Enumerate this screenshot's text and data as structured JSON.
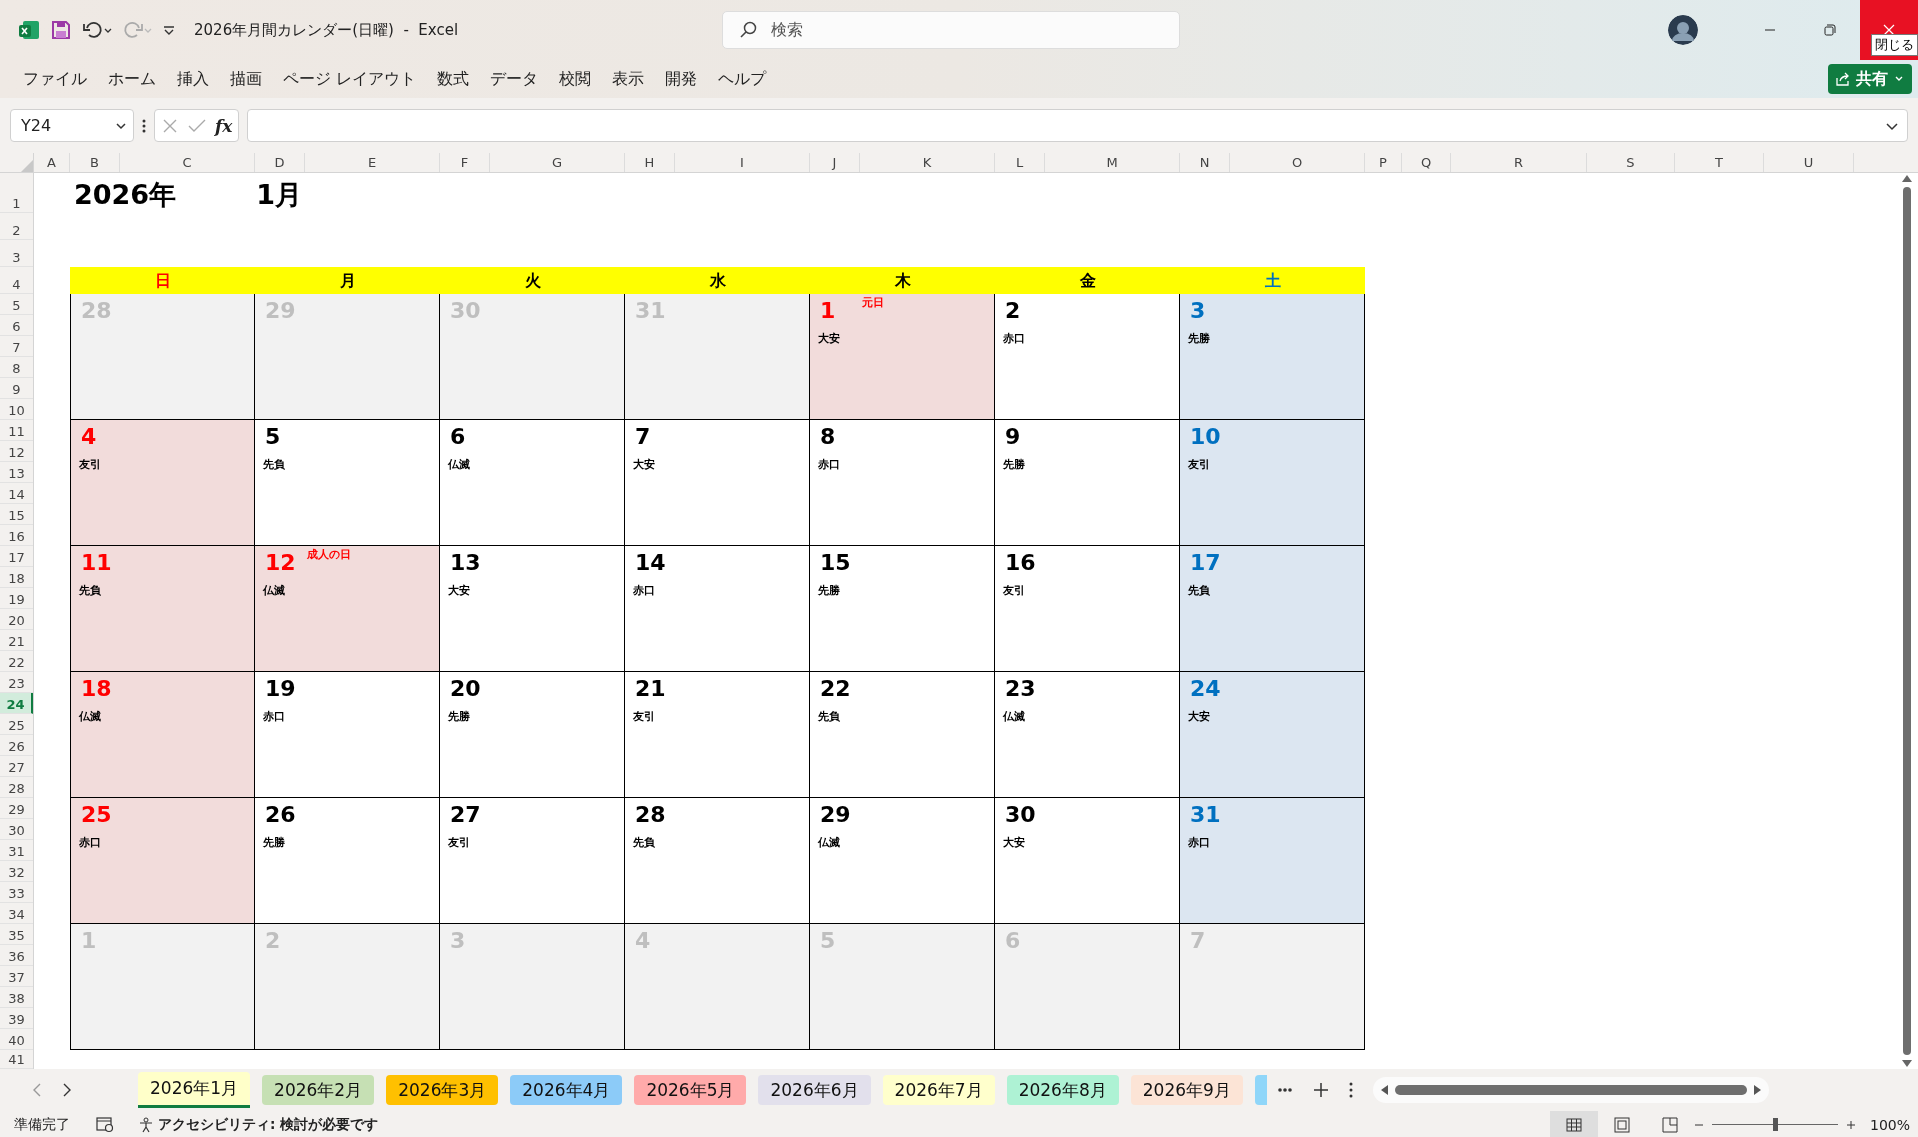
{
  "window": {
    "title": "2026年月間カレンダー(日曜)  -  Excel",
    "search": {
      "placeholder": "検索"
    },
    "close_tooltip": "閉じる"
  },
  "menu": [
    "ファイル",
    "ホーム",
    "挿入",
    "描画",
    "ページ レイアウト",
    "数式",
    "データ",
    "校閲",
    "表示",
    "開発",
    "ヘルプ"
  ],
  "share_button": "共有",
  "formula_bar": {
    "name_box": "Y24",
    "fx": "fx"
  },
  "columns": [
    "A",
    "B",
    "C",
    "D",
    "E",
    "F",
    "G",
    "H",
    "I",
    "J",
    "K",
    "L",
    "M",
    "N",
    "O",
    "P",
    "Q",
    "R",
    "S",
    "T",
    "U"
  ],
  "rows": [
    {
      "label": "1",
      "selected": false
    },
    {
      "label": "2",
      "selected": false
    },
    {
      "label": "3",
      "selected": false
    },
    {
      "label": "4",
      "selected": false
    },
    {
      "label": "5",
      "selected": false
    },
    {
      "label": "6",
      "selected": false
    },
    {
      "label": "7",
      "selected": false
    },
    {
      "label": "8",
      "selected": false
    },
    {
      "label": "9",
      "selected": false
    },
    {
      "label": "10",
      "selected": false
    },
    {
      "label": "11",
      "selected": false
    },
    {
      "label": "12",
      "selected": false
    },
    {
      "label": "13",
      "selected": false
    },
    {
      "label": "14",
      "selected": false
    },
    {
      "label": "15",
      "selected": false
    },
    {
      "label": "16",
      "selected": false
    },
    {
      "label": "17",
      "selected": false
    },
    {
      "label": "18",
      "selected": false
    },
    {
      "label": "19",
      "selected": false
    },
    {
      "label": "20",
      "selected": false
    },
    {
      "label": "21",
      "selected": false
    },
    {
      "label": "22",
      "selected": false
    },
    {
      "label": "23",
      "selected": false
    },
    {
      "label": "24",
      "selected": true
    },
    {
      "label": "25",
      "selected": false
    },
    {
      "label": "26",
      "selected": false
    },
    {
      "label": "27",
      "selected": false
    },
    {
      "label": "28",
      "selected": false
    },
    {
      "label": "29",
      "selected": false
    },
    {
      "label": "30",
      "selected": false
    },
    {
      "label": "31",
      "selected": false
    },
    {
      "label": "32",
      "selected": false
    },
    {
      "label": "33",
      "selected": false
    },
    {
      "label": "34",
      "selected": false
    },
    {
      "label": "35",
      "selected": false
    },
    {
      "label": "36",
      "selected": false
    },
    {
      "label": "37",
      "selected": false
    },
    {
      "label": "38",
      "selected": false
    },
    {
      "label": "39",
      "selected": false
    },
    {
      "label": "40",
      "selected": false
    },
    {
      "label": "41",
      "selected": false
    }
  ],
  "calendar": {
    "year": "2026年",
    "month": "1月",
    "weekdays": [
      {
        "label": "日",
        "kind": "sunday"
      },
      {
        "label": "月",
        "kind": "weekday"
      },
      {
        "label": "火",
        "kind": "weekday"
      },
      {
        "label": "水",
        "kind": "weekday"
      },
      {
        "label": "木",
        "kind": "weekday"
      },
      {
        "label": "金",
        "kind": "weekday"
      },
      {
        "label": "土",
        "kind": "saturday"
      }
    ],
    "weeks": [
      [
        {
          "day": "28",
          "kind": "other"
        },
        {
          "day": "29",
          "kind": "other"
        },
        {
          "day": "30",
          "kind": "other"
        },
        {
          "day": "31",
          "kind": "other"
        },
        {
          "day": "1",
          "kind": "holiday",
          "rokuyo": "大安",
          "holiday": "元日"
        },
        {
          "day": "2",
          "kind": "weekday",
          "rokuyo": "赤口"
        },
        {
          "day": "3",
          "kind": "saturday",
          "rokuyo": "先勝"
        }
      ],
      [
        {
          "day": "4",
          "kind": "sunday",
          "rokuyo": "友引"
        },
        {
          "day": "5",
          "kind": "weekday",
          "rokuyo": "先負"
        },
        {
          "day": "6",
          "kind": "weekday",
          "rokuyo": "仏滅"
        },
        {
          "day": "7",
          "kind": "weekday",
          "rokuyo": "大安"
        },
        {
          "day": "8",
          "kind": "weekday",
          "rokuyo": "赤口"
        },
        {
          "day": "9",
          "kind": "weekday",
          "rokuyo": "先勝"
        },
        {
          "day": "10",
          "kind": "saturday",
          "rokuyo": "友引"
        }
      ],
      [
        {
          "day": "11",
          "kind": "sunday",
          "rokuyo": "先負"
        },
        {
          "day": "12",
          "kind": "holiday",
          "rokuyo": "仏滅",
          "holiday": "成人の日"
        },
        {
          "day": "13",
          "kind": "weekday",
          "rokuyo": "大安"
        },
        {
          "day": "14",
          "kind": "weekday",
          "rokuyo": "赤口"
        },
        {
          "day": "15",
          "kind": "weekday",
          "rokuyo": "先勝"
        },
        {
          "day": "16",
          "kind": "weekday",
          "rokuyo": "友引"
        },
        {
          "day": "17",
          "kind": "saturday",
          "rokuyo": "先負"
        }
      ],
      [
        {
          "day": "18",
          "kind": "sunday",
          "rokuyo": "仏滅"
        },
        {
          "day": "19",
          "kind": "weekday",
          "rokuyo": "赤口"
        },
        {
          "day": "20",
          "kind": "weekday",
          "rokuyo": "先勝"
        },
        {
          "day": "21",
          "kind": "weekday",
          "rokuyo": "友引"
        },
        {
          "day": "22",
          "kind": "weekday",
          "rokuyo": "先負"
        },
        {
          "day": "23",
          "kind": "weekday",
          "rokuyo": "仏滅"
        },
        {
          "day": "24",
          "kind": "saturday",
          "rokuyo": "大安"
        }
      ],
      [
        {
          "day": "25",
          "kind": "sunday",
          "rokuyo": "赤口"
        },
        {
          "day": "26",
          "kind": "weekday",
          "rokuyo": "先勝"
        },
        {
          "day": "27",
          "kind": "weekday",
          "rokuyo": "友引"
        },
        {
          "day": "28",
          "kind": "weekday",
          "rokuyo": "先負"
        },
        {
          "day": "29",
          "kind": "weekday",
          "rokuyo": "仏滅"
        },
        {
          "day": "30",
          "kind": "weekday",
          "rokuyo": "大安"
        },
        {
          "day": "31",
          "kind": "saturday",
          "rokuyo": "赤口"
        }
      ],
      [
        {
          "day": "1",
          "kind": "other"
        },
        {
          "day": "2",
          "kind": "other"
        },
        {
          "day": "3",
          "kind": "other"
        },
        {
          "day": "4",
          "kind": "other"
        },
        {
          "day": "5",
          "kind": "other"
        },
        {
          "day": "6",
          "kind": "other"
        },
        {
          "day": "7",
          "kind": "other"
        }
      ]
    ]
  },
  "sheet_tabs": [
    {
      "label": "2026年1月",
      "color": "#ffffc9",
      "selected": true
    },
    {
      "label": "2026年2月",
      "color": "#c6e0b4",
      "selected": false
    },
    {
      "label": "2026年3月",
      "color": "#ffc000",
      "selected": false
    },
    {
      "label": "2026年4月",
      "color": "#8ccbf8",
      "selected": false
    },
    {
      "label": "2026年5月",
      "color": "#ffaaaa",
      "selected": false
    },
    {
      "label": "2026年6月",
      "color": "#e2e0ec",
      "selected": false
    },
    {
      "label": "2026年7月",
      "color": "#ffffcc",
      "selected": false
    },
    {
      "label": "2026年8月",
      "color": "#aef2d4",
      "selected": false
    },
    {
      "label": "2026年9月",
      "color": "#fce4d6",
      "selected": false
    }
  ],
  "partial_tab": {
    "color": "#8fd6f9"
  },
  "status_bar": {
    "ready": "準備完了",
    "accessibility": "アクセシビリティ: 検討が必要です",
    "zoom": "100%",
    "zoom_slider": {
      "level": 0.5
    }
  }
}
